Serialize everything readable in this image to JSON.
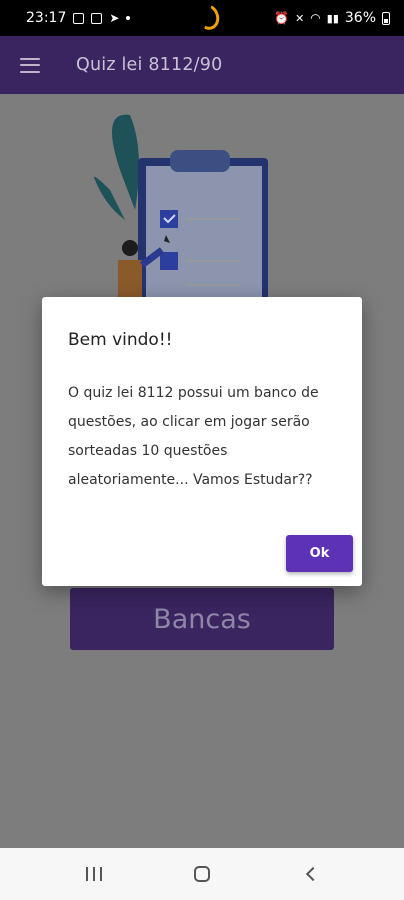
{
  "status_bar": {
    "time": "23:17",
    "battery": "36%"
  },
  "app_bar": {
    "title": "Quiz lei 8112/90",
    "menu_icon": "menu-icon"
  },
  "main": {
    "bancas_label": "Bancas"
  },
  "dialog": {
    "title": "Bem vindo!!",
    "message": "O quiz lei 8112 possui um banco de questões, ao clicar em jogar serão sorteadas 10 questões aleatoriamente... Vamos Estudar??",
    "ok_label": "Ok"
  },
  "nav_bar": {
    "recents": "recents-icon",
    "home": "home-icon",
    "back": "back-icon"
  },
  "colors": {
    "app_bar": "#3b2561",
    "ok_button": "#5e32b4",
    "scrim_background": "#7d7d7d"
  }
}
